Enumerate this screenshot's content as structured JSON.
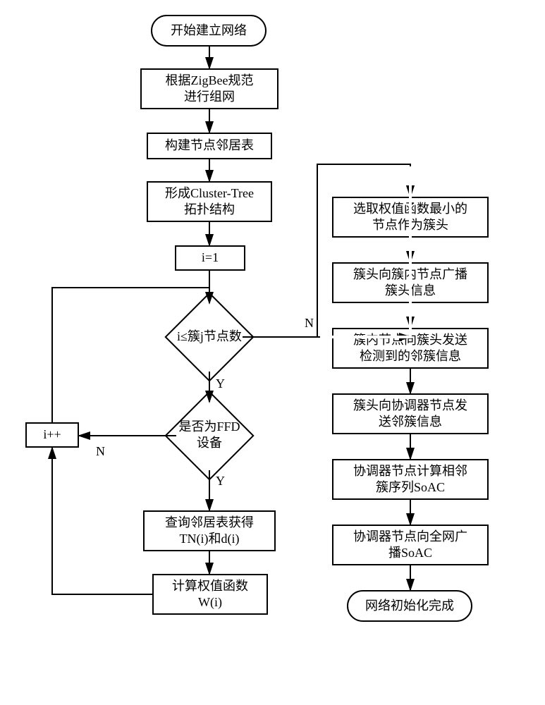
{
  "flowchart": {
    "start": "开始建立网络",
    "step_zigbee": "根据ZigBee规范\n进行组网",
    "step_neighbor": "构建节点邻居表",
    "step_cluster": "形成Cluster-Tree\n拓扑结构",
    "step_init_i": "i=1",
    "decision_count": "i≤簇j节点数",
    "decision_ffd": "是否为FFD\n设备",
    "step_increment": "i++",
    "step_query": "查询邻居表获得\nTN(i)和d(i)",
    "step_weight": "计算权值函数\nW(i)",
    "step_select_head": "选取权值函数最小的\n节点作为簇头",
    "step_broadcast_head": "簇头向簇内节点广播\n簇头信息",
    "step_send_detect": "簇内节点向簇头发送\n检测到的邻簇信息",
    "step_send_coord": "簇头向协调器节点发\n送邻簇信息",
    "step_calc_soac": "协调器节点计算相邻\n簇序列SoAC",
    "step_broadcast_soac": "协调器节点向全网广\n播SoAC",
    "end": "网络初始化完成",
    "yes": "Y",
    "no": "N"
  }
}
